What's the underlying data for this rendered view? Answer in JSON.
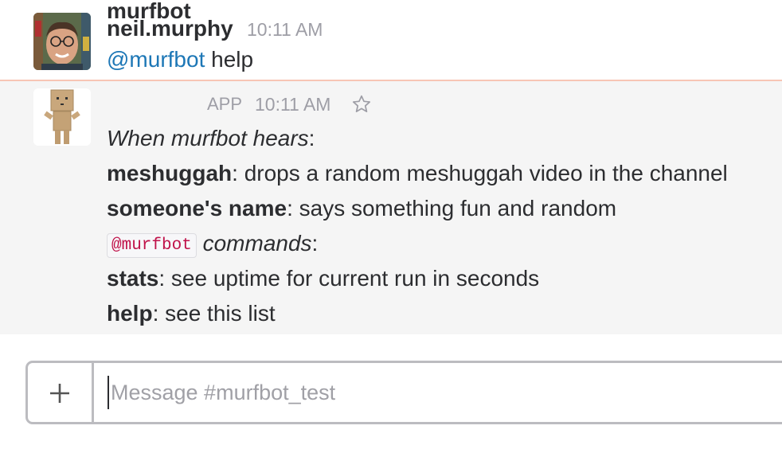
{
  "messages": [
    {
      "sender": "neil.murphy",
      "time": "10:11 AM",
      "avatar": "user-photo-avatar",
      "mention": "@murfbot",
      "text": " help"
    },
    {
      "sender": "murfbot",
      "app_tag": "APP",
      "time": "10:11 AM",
      "avatar": "cardboard-robot-avatar",
      "star_icon": "star-outline-icon",
      "lines": {
        "hears_label": "When murfbot hears",
        "colon": ":",
        "meshuggah_key": "meshuggah",
        "meshuggah_desc": ": drops a random meshuggah video in the channel",
        "name_key": "someone's name",
        "name_desc": ": says something fun and random",
        "code_mention": "@murfbot",
        "commands_label": "commands",
        "stats_key": "stats",
        "stats_desc": ": see uptime for current run in seconds",
        "help_key": "help",
        "help_desc": ": see this list"
      }
    }
  ],
  "composer": {
    "plus_icon": "plus-icon",
    "placeholder": "Message #murfbot_test"
  },
  "colors": {
    "mention": "#1d77b6",
    "code_text": "#c0134a",
    "new_divider": "#f7c5b5",
    "bot_bg": "#f5f5f5"
  }
}
